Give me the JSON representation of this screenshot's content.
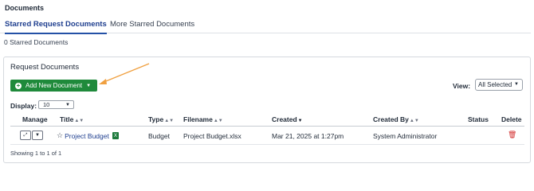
{
  "section_title": "Documents",
  "tabs": [
    {
      "label": "Starred Request Documents",
      "active": true
    },
    {
      "label": "More Starred Documents",
      "active": false
    }
  ],
  "starred_count_text": "0 Starred Documents",
  "panel": {
    "title": "Request Documents",
    "add_button_label": "Add New Document",
    "view_label": "View:",
    "view_value": "All Selected",
    "display_label": "Display:",
    "display_value": "10",
    "columns": {
      "manage": "Manage",
      "title": "Title",
      "type": "Type",
      "filename": "Filename",
      "created": "Created",
      "created_by": "Created By",
      "status": "Status",
      "delete": "Delete"
    },
    "rows": [
      {
        "title": "Project Budget",
        "type": "Budget",
        "filename": "Project Budget.xlsx",
        "created": "Mar 21, 2025 at 1:27pm",
        "created_by": "System Administrator",
        "status": ""
      }
    ],
    "showing_text": "Showing 1 to 1 of 1"
  },
  "colors": {
    "accent_blue": "#1f3f8f",
    "add_button_green": "#1f8a3b",
    "annotation_arrow": "#f0a040",
    "delete_red": "#d12b2b"
  },
  "icons": [
    "plus-circle-icon",
    "chevron-down-icon",
    "sort-icon",
    "expand-icon",
    "star-icon",
    "excel-file-icon",
    "trash-icon"
  ]
}
